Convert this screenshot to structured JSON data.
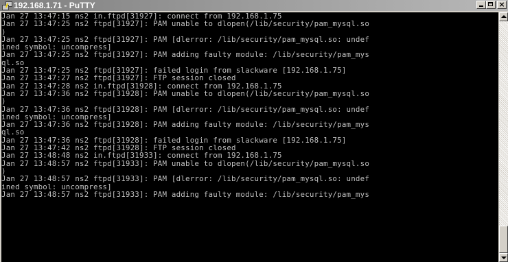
{
  "window": {
    "title": "192.168.1.71 - PuTTY",
    "controls": {
      "minimize": "minimize",
      "maximize": "maximize",
      "close": "×"
    }
  },
  "icons": {
    "app": "putty-icon",
    "minimize": "minimize-icon",
    "maximize": "maximize-icon",
    "close": "close-icon"
  },
  "terminal": {
    "lines": [
      "Jan 27 13:47:15 ns2 in.ftpd[31927]: connect from 192.168.1.75",
      "Jan 27 13:47:25 ns2 ftpd[31927]: PAM unable to dlopen(/lib/security/pam_mysql.so",
      ")",
      "Jan 27 13:47:25 ns2 ftpd[31927]: PAM [dlerror: /lib/security/pam_mysql.so: undef",
      "ined symbol: uncompress]",
      "Jan 27 13:47:25 ns2 ftpd[31927]: PAM adding faulty module: /lib/security/pam_mys",
      "ql.so",
      "Jan 27 13:47:25 ns2 ftpd[31927]: failed login from slackware [192.168.1.75]",
      "Jan 27 13:47:27 ns2 ftpd[31927]: FTP session closed",
      "Jan 27 13:47:28 ns2 in.ftpd[31928]: connect from 192.168.1.75",
      "Jan 27 13:47:36 ns2 ftpd[31928]: PAM unable to dlopen(/lib/security/pam_mysql.so",
      ")",
      "Jan 27 13:47:36 ns2 ftpd[31928]: PAM [dlerror: /lib/security/pam_mysql.so: undef",
      "ined symbol: uncompress]",
      "Jan 27 13:47:36 ns2 ftpd[31928]: PAM adding faulty module: /lib/security/pam_mys",
      "ql.so",
      "Jan 27 13:47:36 ns2 ftpd[31928]: failed login from slackware [192.168.1.75]",
      "Jan 27 13:47:42 ns2 ftpd[31928]: FTP session closed",
      "Jan 27 13:48:48 ns2 in.ftpd[31933]: connect from 192.168.1.75",
      "Jan 27 13:48:57 ns2 ftpd[31933]: PAM unable to dlopen(/lib/security/pam_mysql.so",
      ")",
      "Jan 27 13:48:57 ns2 ftpd[31933]: PAM [dlerror: /lib/security/pam_mysql.so: undef",
      "ined symbol: uncompress]",
      "Jan 27 13:48:57 ns2 ftpd[31933]: PAM adding faulty module: /lib/security/pam_mys"
    ]
  },
  "scrollbar": {
    "up": "scroll-up-arrow-icon",
    "down": "scroll-down-arrow-icon"
  },
  "colors": {
    "terminal_bg": "#000000",
    "terminal_fg": "#c0c0c0",
    "titlebar": "#808080"
  }
}
